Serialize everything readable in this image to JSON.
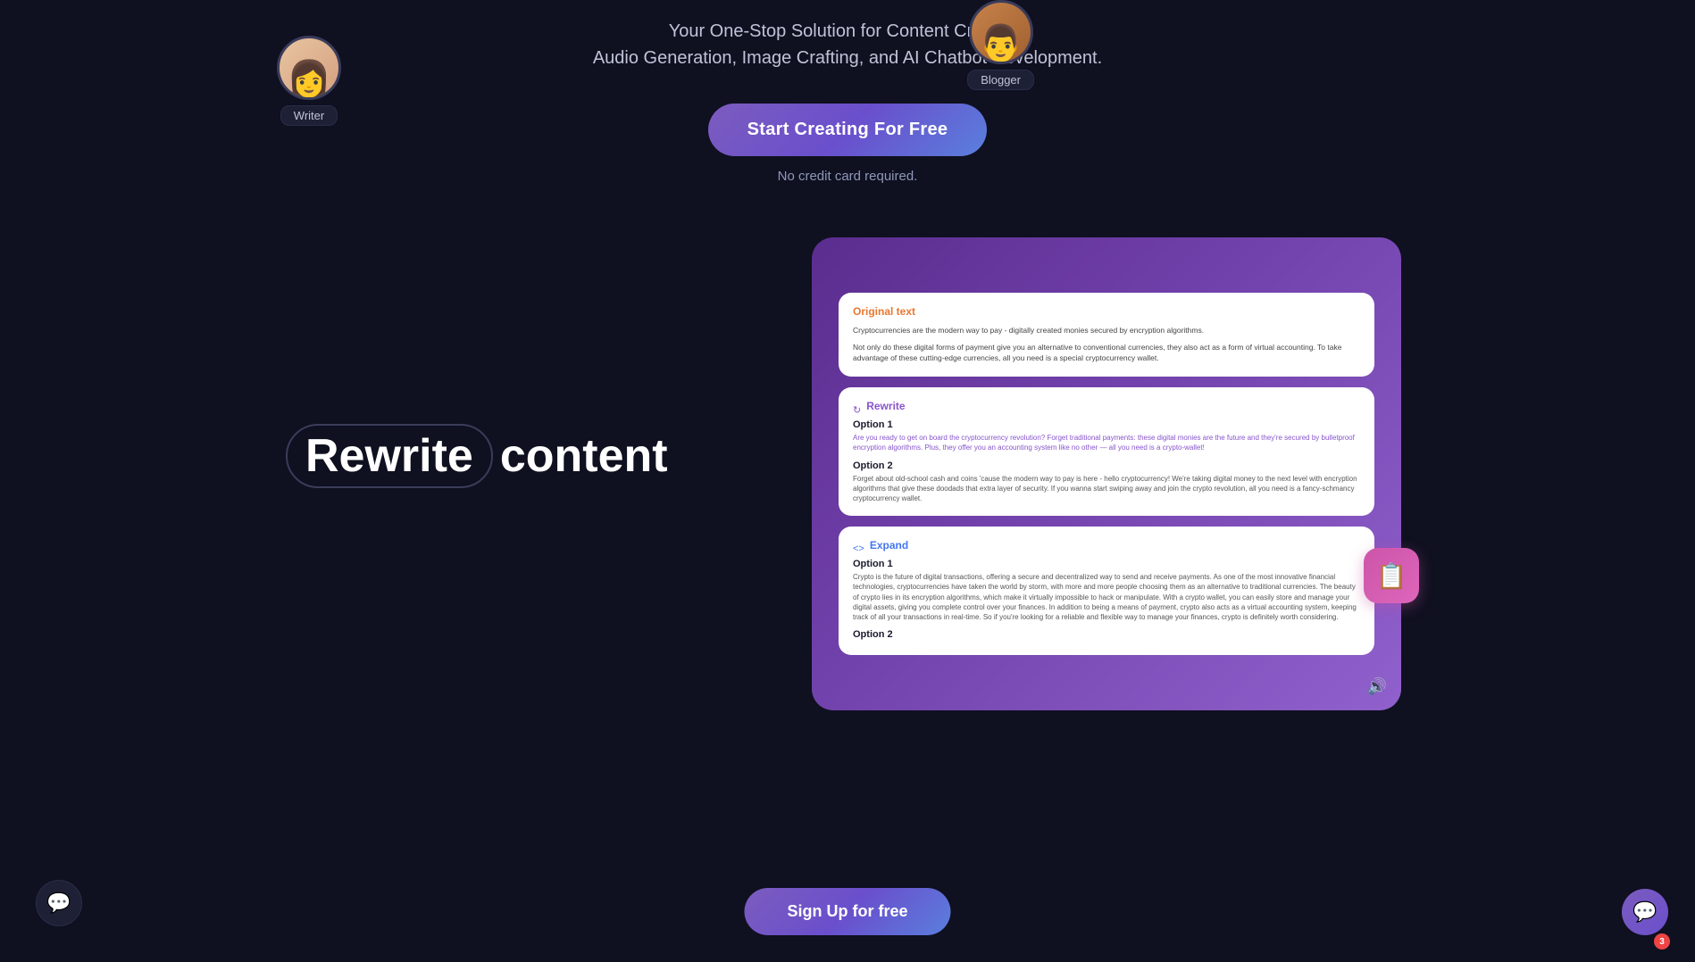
{
  "hero": {
    "tagline_line1": "Your One-Stop Solution for Content Creation,",
    "tagline_line2": "Audio Generation, Image Crafting, and AI Chatbot Development.",
    "cta_label": "Start Creating For Free",
    "no_cc_text": "No credit card required."
  },
  "personas": {
    "writer": {
      "label": "Writer",
      "emoji": "👩"
    },
    "blogger": {
      "label": "Blogger",
      "emoji": "👨"
    }
  },
  "feature": {
    "heading_highlight": "Rewrite",
    "heading_rest": " content"
  },
  "cards": {
    "original": {
      "label": "Original text",
      "body1": "Cryptocurrencies are the modern way to pay - digitally created monies secured by encryption algorithms.",
      "body2": "Not only do these digital forms of payment give you an alternative to conventional currencies, they also act as a form of virtual accounting. To take advantage of these cutting-edge currencies, all you need is a special cryptocurrency wallet."
    },
    "rewrite": {
      "label": "Rewrite",
      "option1_title": "Option 1",
      "option1_text": "Are you ready to get on board the cryptocurrency revolution? Forget traditional payments: these digital monies are the future and they're secured by bulletproof encryption algorithms. Plus, they offer you an accounting system like no other — all you need is a crypto-wallet!",
      "option2_title": "Option 2",
      "option2_text": "Forget about old-school cash and coins 'cause the modern way to pay is here - hello cryptocurrency! We're taking digital money to the next level with encryption algorithms that give these doodads that extra layer of security. If you wanna start swiping away and join the crypto revolution, all you need is a fancy-schmancy cryptocurrency wallet."
    },
    "expand": {
      "label": "Expand",
      "option1_title": "Option 1",
      "option1_text": "Crypto is the future of digital transactions, offering a secure and decentralized way to send and receive payments. As one of the most innovative financial technologies, cryptocurrencies have taken the world by storm, with more and more people choosing them as an alternative to traditional currencies. The beauty of crypto lies in its encryption algorithms, which make it virtually impossible to hack or manipulate. With a crypto wallet, you can easily store and manage your digital assets, giving you complete control over your finances. In addition to being a means of payment, crypto also acts as a virtual accounting system, keeping track of all your transactions in real-time. So if you're looking for a reliable and flexible way to manage your finances, crypto is definitely worth considering.",
      "option2_title": "Option 2"
    }
  },
  "bottom": {
    "chat_icon": "💬",
    "signup_label": "Sign Up for free",
    "notification_icon": "💬",
    "notification_count": "3"
  }
}
